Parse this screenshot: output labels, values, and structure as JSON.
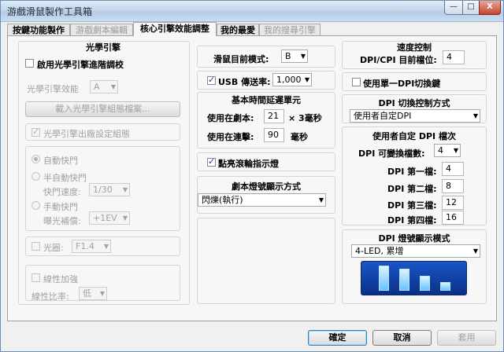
{
  "window": {
    "title": "游戲滑鼠製作工具箱",
    "min": "—",
    "max": "□",
    "close": "X"
  },
  "tabs": [
    {
      "label": "按鍵功能製作",
      "state": "normal"
    },
    {
      "label": "游戲劇本編輯",
      "state": "disabled"
    },
    {
      "label": "核心引擎效能調整",
      "state": "active"
    },
    {
      "label": "我的最愛",
      "state": "normal"
    },
    {
      "label": "我的搜尋引擎",
      "state": "disabled"
    }
  ],
  "optical": {
    "title": "光學引擎",
    "advanced_label": "啟用光學引擎進階調校",
    "efficiency_label": "光學引擎效能",
    "efficiency_value": "A",
    "load_button": "載入光學引擎組態檔案...",
    "factory_label": "光學引擎出廠設定組態",
    "auto_shutter": "自動快門",
    "semi_auto_shutter": "半自動快門",
    "shutter_speed_label": "快門速度:",
    "shutter_speed_value": "1/30",
    "manual_shutter": "手動快門",
    "exposure_label": "曝光補償:",
    "exposure_value": "+1EV",
    "aperture_label": "光圈:",
    "aperture_value": "F1.4",
    "linear_label": "線性加強",
    "linear_ratio_label": "線性比率:",
    "linear_ratio_value": "低"
  },
  "middle": {
    "scroll_mode_label": "滑鼠目前模式:",
    "scroll_mode_value": "B",
    "usb_label": "USB 傳送率:",
    "usb_value": "1,000",
    "delay_title": "基本時間延遲單元",
    "script_label": "使用在劇本:",
    "script_value": "21",
    "script_unit": "× 3毫秒",
    "macro_label": "使用在連擊:",
    "macro_value": "90",
    "macro_unit": "毫秒",
    "wheel_light_label": "點亮滾輪指示燈",
    "script_light_title": "劇本燈號顯示方式",
    "script_light_value": "閃爍(執行)"
  },
  "speed": {
    "title": "速度控制",
    "dpi_label": "DPI/CPI 目前檔位:",
    "dpi_value": "4",
    "single_dpi_label": "使用單一DPI切換鍵",
    "dpi_switch_title": "DPI 切換控制方式",
    "dpi_switch_value": "使用者自定DPI",
    "custom_title": "使用者自定 DPI 檔次",
    "changeable_label": "DPI 可變換檔數:",
    "changeable_value": "4",
    "levels": [
      {
        "label": "DPI 第一檔:",
        "value": "4"
      },
      {
        "label": "DPI 第二檔:",
        "value": "8"
      },
      {
        "label": "DPI 第三檔:",
        "value": "12"
      },
      {
        "label": "DPI 第四檔:",
        "value": "16"
      }
    ],
    "led_title": "DPI 燈號顯示模式",
    "led_value": "4-LED, 累增",
    "led_levels": [
      1,
      0.85,
      0.55,
      0.3
    ]
  },
  "footer": {
    "ok": "確定",
    "cancel": "取消",
    "apply": "套用"
  }
}
